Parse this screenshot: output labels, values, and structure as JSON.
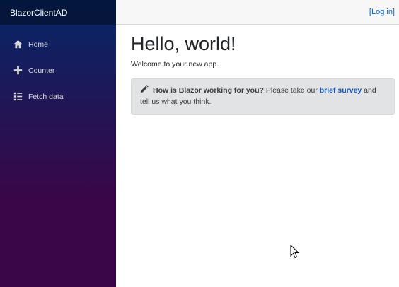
{
  "sidebar": {
    "brand": "BlazorClientAD",
    "items": [
      {
        "label": "Home",
        "icon": "home-icon"
      },
      {
        "label": "Counter",
        "icon": "plus-icon"
      },
      {
        "label": "Fetch data",
        "icon": "list-icon"
      }
    ]
  },
  "topbar": {
    "login_label": "[Log in]"
  },
  "main": {
    "title": "Hello, world!",
    "welcome": "Welcome to your new app.",
    "survey": {
      "question": "How is Blazor working for you?",
      "text_before": " Please take our ",
      "link_label": "brief survey",
      "text_after": " and tell us what you think."
    }
  },
  "colors": {
    "sidebar_top": "#052767",
    "sidebar_bottom": "#3a0647",
    "link": "#0366d6"
  }
}
